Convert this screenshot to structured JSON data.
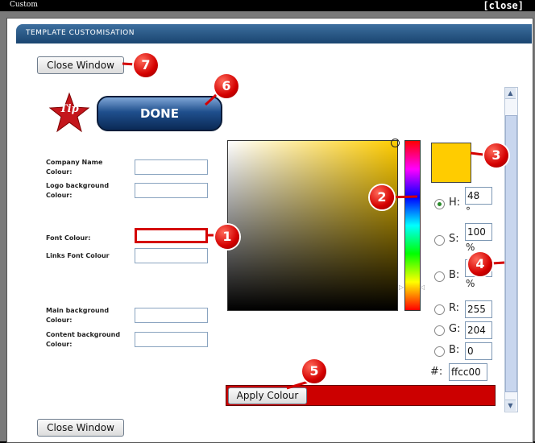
{
  "window": {
    "title": "Custom",
    "close_label": "[close]"
  },
  "dialog": {
    "header": "TEMPLATE CUSTOMISATION",
    "close_window_top": "Close Window",
    "close_window_bottom": "Close Window",
    "tip_text": "Tip",
    "done_label": "DONE"
  },
  "fields": {
    "company_name": "Company Name Colour:",
    "logo_bg": "Logo background Colour:",
    "font_colour": "Font Colour:",
    "links_font": "Links Font Colour",
    "main_bg": "Main background Colour:",
    "content_bg": "Content background Colour:"
  },
  "picker": {
    "h_label": "H:",
    "h_value": "48",
    "h_unit": "°",
    "s_label": "S:",
    "s_value": "100",
    "s_unit": "%",
    "b_label": "B:",
    "b_value": "",
    "b_unit": "%",
    "r_label": "R:",
    "r_value": "255",
    "g_label": "G:",
    "g_value": "204",
    "blue_label": "B:",
    "blue_value": "0",
    "hex_label": "#:",
    "hex_value": "ffcc00",
    "selected": "H",
    "swatch_color": "#ffcc00"
  },
  "apply_label": "Apply Colour",
  "apply_bar_color": "#cc0000",
  "markers": [
    "1",
    "2",
    "3",
    "4",
    "5",
    "6",
    "7"
  ]
}
